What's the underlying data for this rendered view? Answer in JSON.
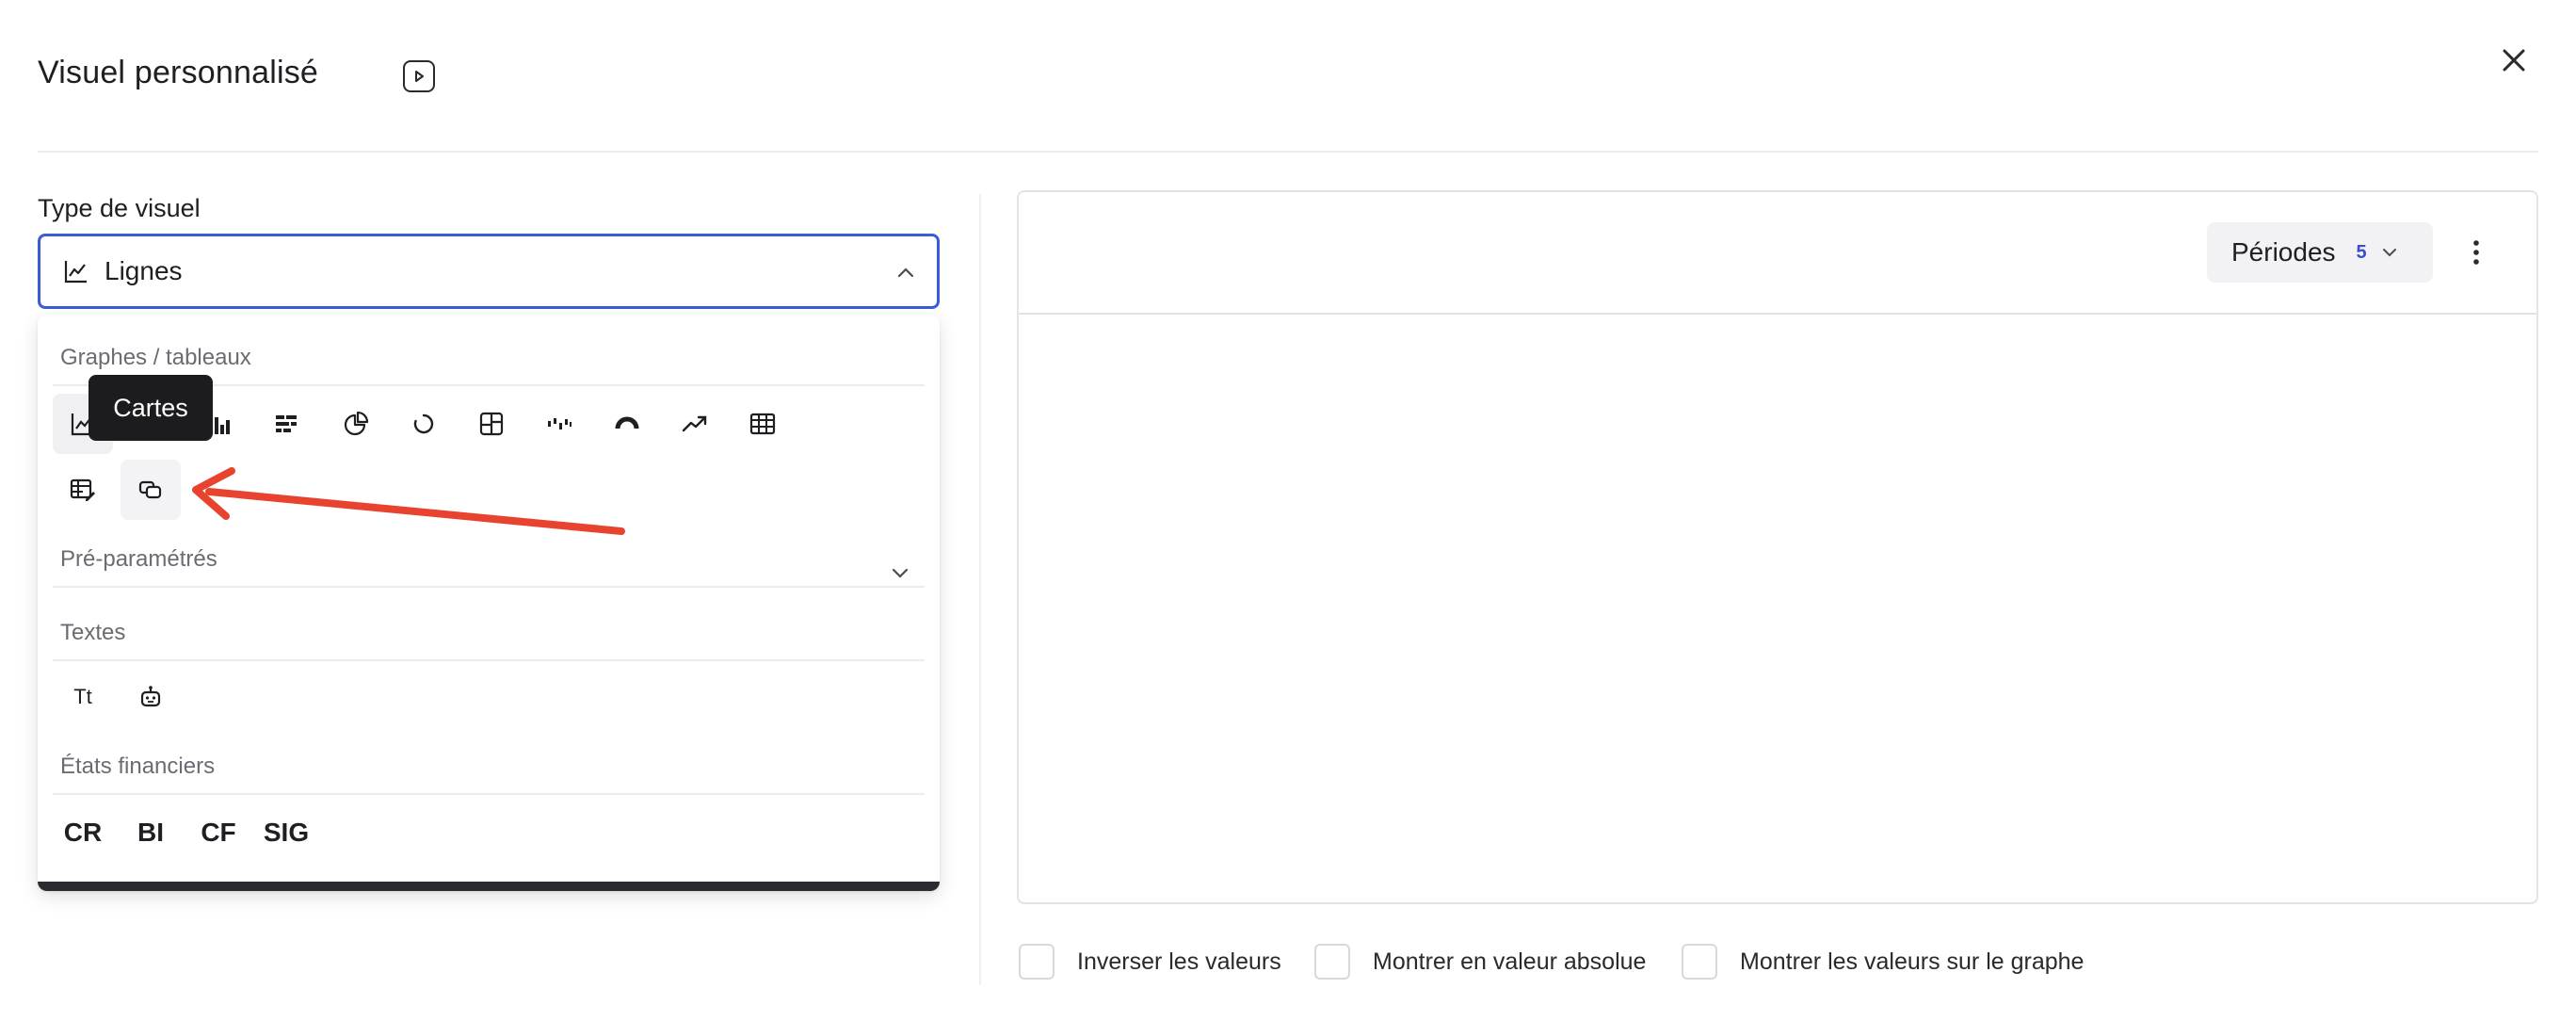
{
  "header": {
    "title": "Visuel personnalisé"
  },
  "left": {
    "type_label": "Type de visuel",
    "selected_type": "Lignes",
    "sections": [
      {
        "title": "Graphes / tableaux"
      },
      {
        "title": "Pré-paramétrés"
      },
      {
        "title": "Textes"
      },
      {
        "title": "États financiers"
      }
    ],
    "graph_icons": [
      "line-chart-icon",
      "horizontal-bar-icon",
      "vertical-bar-icon",
      "stacked-bar-icon",
      "pie-chart-icon",
      "donut-icon",
      "treemap-icon",
      "waterfall-icon",
      "gauge-icon",
      "trend-icon",
      "table-icon",
      "table-edit-icon",
      "cards-icon"
    ],
    "text_items": {
      "text_label": "Tt",
      "bot_icon": "robot-icon"
    },
    "financial": [
      "CR",
      "BI",
      "CF",
      "SIG"
    ],
    "tooltip": "Cartes"
  },
  "right": {
    "periods_label": "Périodes",
    "periods_count": "5",
    "checkboxes": [
      "Inverser les valeurs",
      "Montrer en valeur absolue",
      "Montrer les valeurs sur le graphe"
    ]
  },
  "colors": {
    "accent": "#3b5bdb",
    "annotation_arrow": "#e8432e",
    "tooltip_bg": "#1c1c1e"
  }
}
